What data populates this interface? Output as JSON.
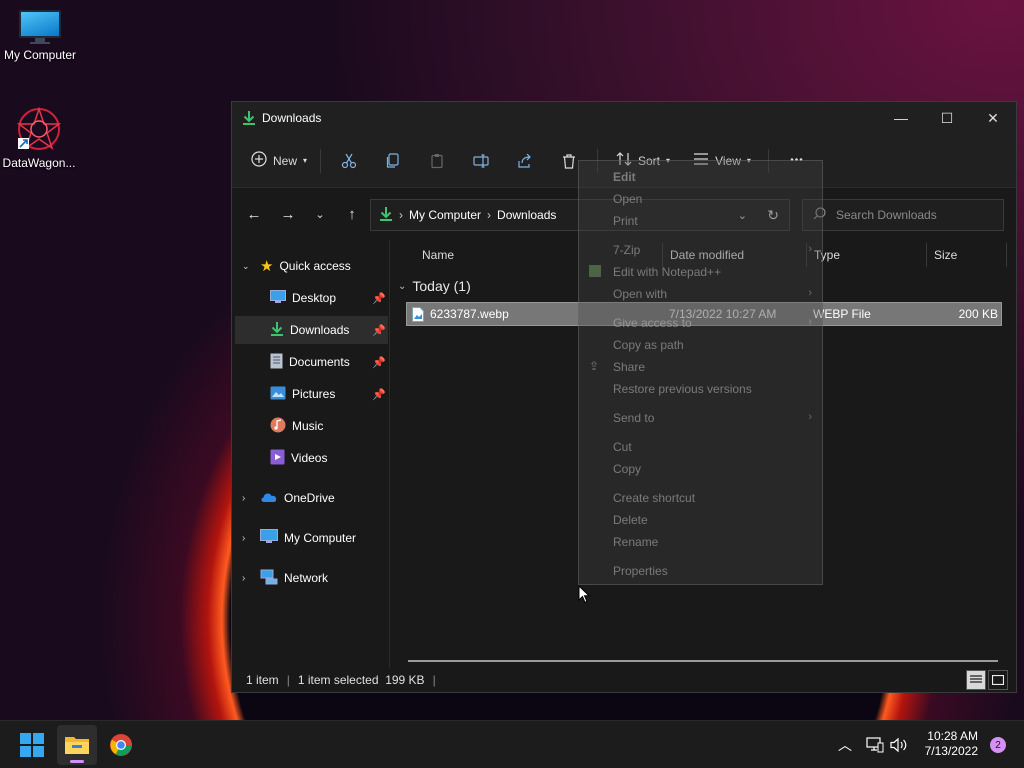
{
  "desktop": {
    "icons": [
      {
        "label": "My Computer"
      },
      {
        "label": "DataWagon..."
      }
    ]
  },
  "window": {
    "title": "Downloads",
    "controls": {
      "minimize": "—",
      "maximize": "☐",
      "close": "✕"
    }
  },
  "toolbar": {
    "new_label": "New",
    "sort_label": "Sort",
    "view_label": "View",
    "more_label": "•••"
  },
  "address": {
    "crumbs": [
      "My Computer",
      "Downloads"
    ],
    "search_placeholder": "Search Downloads"
  },
  "sidebar": {
    "quick_access": "Quick access",
    "items": [
      {
        "label": "Desktop"
      },
      {
        "label": "Downloads"
      },
      {
        "label": "Documents"
      },
      {
        "label": "Pictures"
      },
      {
        "label": "Music"
      },
      {
        "label": "Videos"
      }
    ],
    "roots": [
      {
        "label": "OneDrive"
      },
      {
        "label": "My Computer"
      },
      {
        "label": "Network"
      }
    ]
  },
  "columns": {
    "name": "Name",
    "date": "Date modified",
    "type": "Type",
    "size": "Size"
  },
  "group": {
    "label": "Today (1)"
  },
  "file": {
    "name": "6233787.webp",
    "date": "7/13/2022 10:27 AM",
    "type": "WEBP File",
    "size": "200 KB"
  },
  "status": {
    "count": "1 item",
    "selected": "1 item selected  199 KB"
  },
  "context_menu": {
    "items": [
      {
        "label": "Edit"
      },
      {
        "label": "Open"
      },
      {
        "label": "Print"
      },
      {
        "label": "7-Zip"
      },
      {
        "label": "Edit with Notepad++"
      },
      {
        "label": "Open with"
      },
      {
        "label": "Give access to"
      },
      {
        "label": "Copy as path"
      },
      {
        "label": "Share"
      },
      {
        "label": "Restore previous versions"
      },
      {
        "label": "Send to"
      },
      {
        "label": "Cut"
      },
      {
        "label": "Copy"
      },
      {
        "label": "Create shortcut"
      },
      {
        "label": "Delete"
      },
      {
        "label": "Rename"
      },
      {
        "label": "Properties"
      }
    ]
  },
  "taskbar": {
    "time": "10:28 AM",
    "date": "7/13/2022",
    "notifications": "2"
  }
}
